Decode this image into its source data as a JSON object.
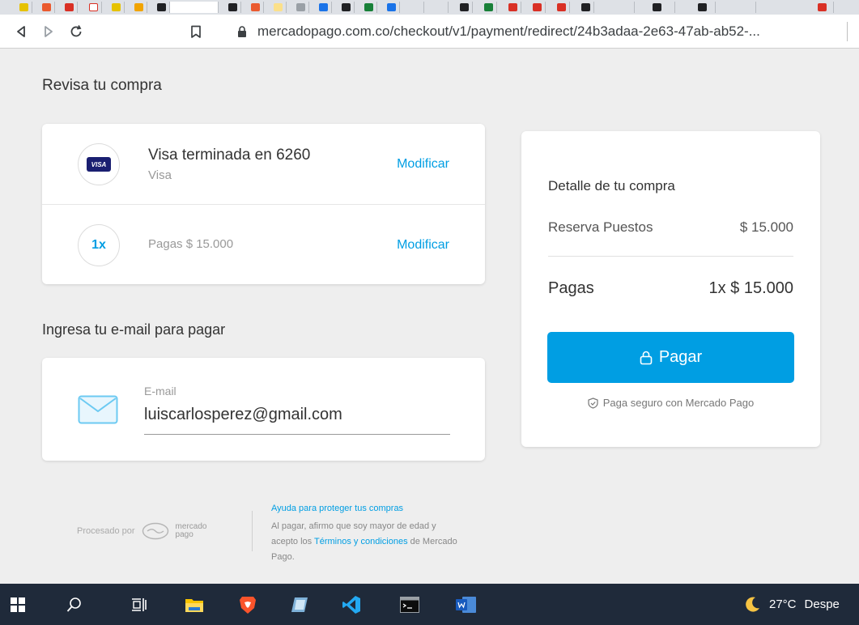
{
  "browser": {
    "url": "mercadopago.com.co/checkout/v1/payment/redirect/24b3adaa-2e63-47ab-ab52-..."
  },
  "review": {
    "title": "Revisa tu compra",
    "card_title": "Visa terminada en 6260",
    "card_sub": "Visa",
    "card_badge": "VISA",
    "modify_label": "Modificar",
    "installments_badge": "1x",
    "installments_text": "Pagas $ 15.000",
    "modify_label_2": "Modificar"
  },
  "email_section": {
    "title": "Ingresa tu e-mail para pagar",
    "label": "E-mail",
    "value": "luiscarlosperez@gmail.com"
  },
  "summary": {
    "title": "Detalle de tu compra",
    "item_name": "Reserva Puestos",
    "item_value": "$ 15.000",
    "pay_label": "Pagas",
    "pay_value": "1x $ 15.000",
    "button_label": "Pagar",
    "secure_text": "Paga seguro con Mercado Pago"
  },
  "footer": {
    "processed_by": "Procesado por",
    "brand_line1": "mercado",
    "brand_line2": "pago",
    "help_link": "Ayuda para proteger tus compras",
    "legal_part1": "Al pagar, afirmo que soy mayor de edad y acepto los",
    "legal_link": "Términos y condiciones",
    "legal_part2": "de Mercado Pago."
  },
  "taskbar": {
    "temperature": "27°C",
    "weather_text": "Despe"
  },
  "colors": {
    "accent": "#009ee3",
    "background": "#eeeeee",
    "taskbar": "#1f2a3a"
  }
}
